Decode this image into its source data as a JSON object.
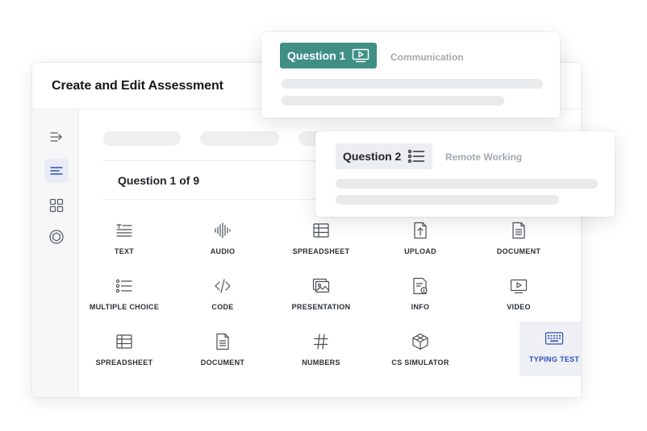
{
  "window": {
    "title": "Create and Edit Assessment"
  },
  "sidebar": {
    "items": [
      {
        "icon": "arrow-right-lines-icon",
        "active": false
      },
      {
        "icon": "align-left-icon",
        "active": true
      },
      {
        "icon": "grid-icon",
        "active": false
      },
      {
        "icon": "settings-circle-icon",
        "active": false
      }
    ]
  },
  "content": {
    "question_counter": "Question 1 of 9"
  },
  "question_types": [
    {
      "label": "TEXT",
      "icon": "text-icon"
    },
    {
      "label": "AUDIO",
      "icon": "audio-icon"
    },
    {
      "label": "SPREADSHEET",
      "icon": "spreadsheet-icon"
    },
    {
      "label": "UPLOAD",
      "icon": "upload-icon"
    },
    {
      "label": "DOCUMENT",
      "icon": "document-icon"
    },
    {
      "label": "MULTIPLE CHOICE",
      "icon": "list-icon"
    },
    {
      "label": "CODE",
      "icon": "code-icon"
    },
    {
      "label": "PRESENTATION",
      "icon": "presentation-icon"
    },
    {
      "label": "INFO",
      "icon": "info-icon"
    },
    {
      "label": "VIDEO",
      "icon": "video-icon"
    },
    {
      "label": "SPREADSHEET",
      "icon": "spreadsheet-icon"
    },
    {
      "label": "DOCUMENT",
      "icon": "document-icon"
    },
    {
      "label": "NUMBERS",
      "icon": "hash-icon"
    },
    {
      "label": "CS SIMULATOR",
      "icon": "cube-icon"
    },
    {
      "label": "TYPING TEST",
      "icon": "keyboard-icon",
      "selected": true
    }
  ],
  "cards": [
    {
      "badge": "Question 1",
      "badge_icon": "video-icon",
      "topic": "Communication"
    },
    {
      "badge": "Question 2",
      "badge_icon": "list-icon",
      "topic": "Remote Working"
    }
  ],
  "colors": {
    "teal_badge": "#3f8f85",
    "selected_text": "#2c4fb8",
    "selected_bg": "#eef0f5",
    "placeholder_bar": "#e9eaec"
  }
}
